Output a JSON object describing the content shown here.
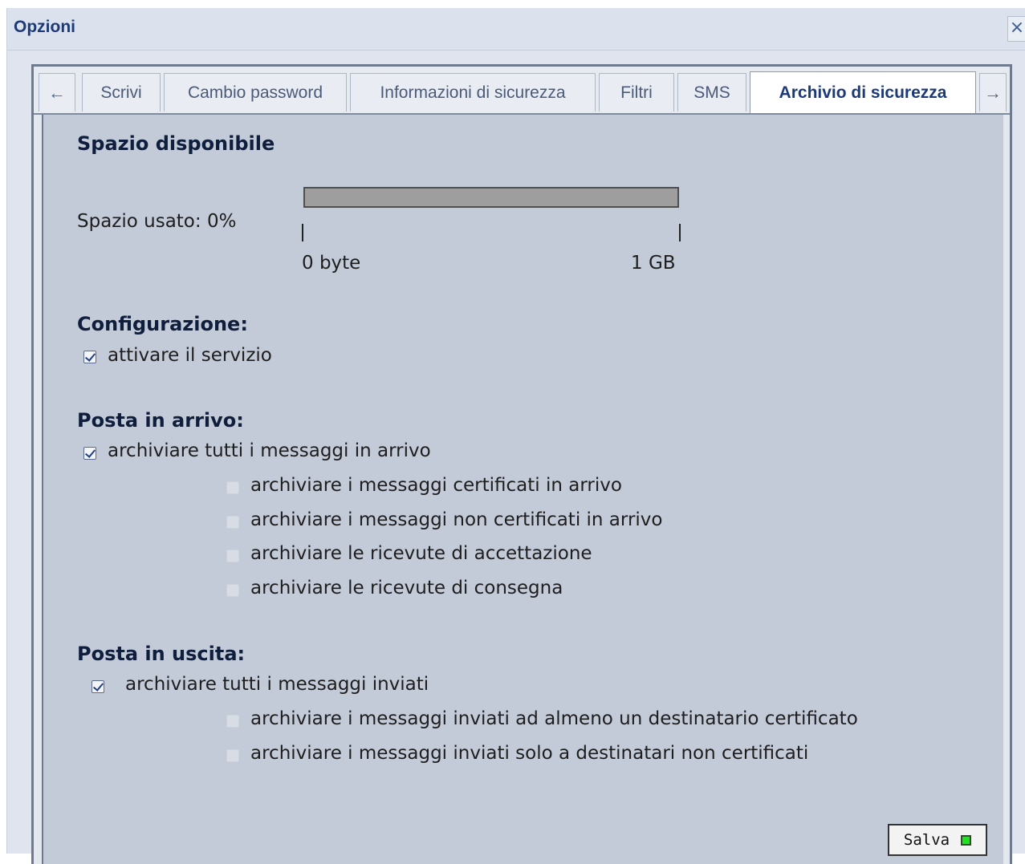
{
  "dialog": {
    "title": "Opzioni",
    "close_glyph": "×"
  },
  "tabs": {
    "prev_arrow": "←",
    "next_arrow": "→",
    "items": [
      "Scrivi",
      "Cambio password",
      "Informazioni di sicurezza",
      "Filtri",
      "SMS",
      "Archivio di sicurezza"
    ],
    "active": "Archivio di sicurezza"
  },
  "space": {
    "heading": "Spazio disponibile",
    "used_label": "Spazio usato: 0%",
    "used_fraction": 0,
    "min_label": "0 byte",
    "max_label": "1 GB"
  },
  "config": {
    "heading": "Configurazione:",
    "activate": {
      "label": "attivare il servizio",
      "checked": true
    }
  },
  "incoming": {
    "heading": "Posta in arrivo:",
    "all": {
      "label": "archiviare tutti i messaggi in arrivo",
      "checked": true
    },
    "options": [
      {
        "label": "archiviare i messaggi certificati in arrivo",
        "checked": false,
        "disabled": true
      },
      {
        "label": "archiviare i messaggi non certificati in arrivo",
        "checked": false,
        "disabled": true
      },
      {
        "label": "archiviare le ricevute di accettazione",
        "checked": false,
        "disabled": true
      },
      {
        "label": "archiviare le ricevute di consegna",
        "checked": false,
        "disabled": true
      }
    ]
  },
  "outgoing": {
    "heading": "Posta in uscita:",
    "all": {
      "label": "archiviare tutti i messaggi inviati",
      "checked": true
    },
    "options": [
      {
        "label": "archiviare i messaggi inviati ad almeno un destinatario certificato",
        "checked": false,
        "disabled": true
      },
      {
        "label": "archiviare i messaggi inviati solo a destinatari non certificati",
        "checked": false,
        "disabled": true
      }
    ]
  },
  "save": {
    "label": "Salva"
  },
  "colors": {
    "title": "#1d3a78",
    "panel": "#c3cad8",
    "save_led": "#22e022"
  }
}
